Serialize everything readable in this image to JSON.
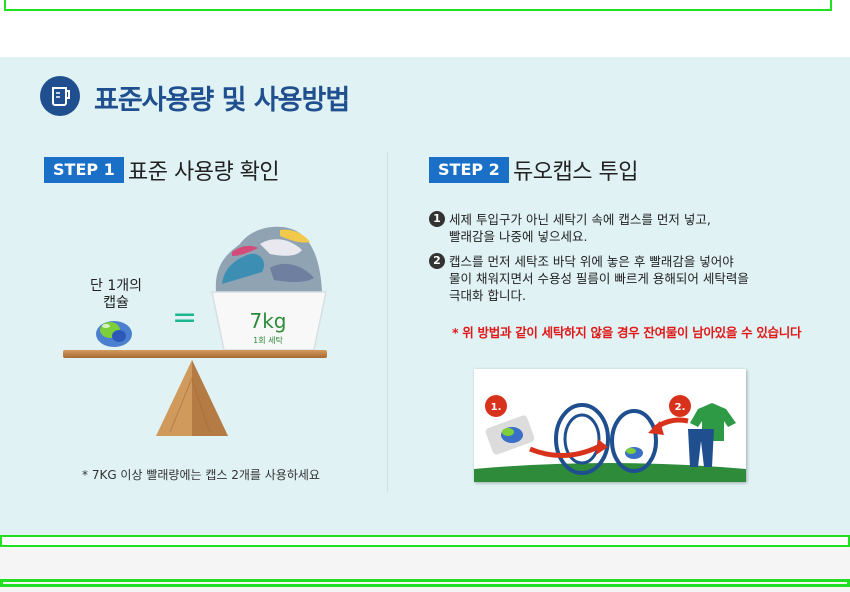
{
  "section": {
    "title": "표준사용량 및 사용방법"
  },
  "step1": {
    "badge": "STEP 1",
    "title": "표준 사용량 확인",
    "cap_label_line1": "단 1개의",
    "cap_label_line2": "캡슐",
    "equals": "=",
    "weight": "7kg",
    "weight_sub": "1회 세탁",
    "note": "* 7KG 이상 빨래량에는 캡스 2개를 사용하세요"
  },
  "step2": {
    "badge": "STEP 2",
    "title": "듀오캡스 투입",
    "bullets": [
      {
        "num": "1",
        "line1": "세제 투입구가 아닌 세탁기 속에 캡스를 먼저 넣고,",
        "line2": "빨래감을 나중에 넣으세요."
      },
      {
        "num": "2",
        "line1": "캡스를 먼저 세탁조 바닥 위에 놓은 후 빨래감을 넣어야",
        "line2": "물이 채워지면서 수용성 필름이 빠르게 용해되어 세탁력을",
        "line3": "극대화 합니다."
      }
    ],
    "warning": "* 위 방법과 같이 세탁하지 않을 경우 잔여물이 남아있을 수 있습니다",
    "image_step1": "1.",
    "image_step2": "2."
  },
  "colors": {
    "accent": "#1f4f8f",
    "badge": "#1a6fc7",
    "panel": "#e0f2f4",
    "warning": "#e01818",
    "outline": "#21e021"
  }
}
